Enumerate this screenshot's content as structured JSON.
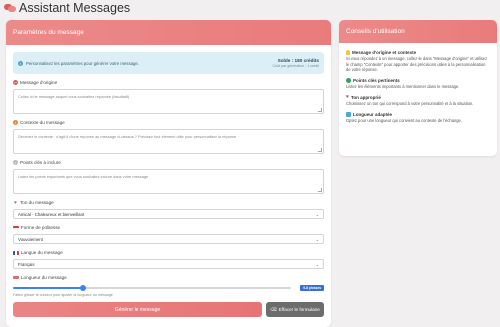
{
  "app": {
    "title": "Assistant Messages"
  },
  "main": {
    "header": "Paramètres du message",
    "info": {
      "text": "Personnalisez les paramètres pour générer votre message.",
      "balance": "Solde : 180 crédits",
      "cost": "Coût par génération : 1 crédit"
    },
    "fields": {
      "original": {
        "label": "Message d'origine",
        "placeholder": "Collez ici le message auquel vous souhaitez répondre (facultatif)"
      },
      "context": {
        "label": "Contexte du message",
        "placeholder": "Décrivez le contexte : s'agit-il d'une réponse au message ci-dessus ? Précisez tout élément utile pour personnaliser la réponse"
      },
      "keypoints": {
        "label": "Points clés à inclure",
        "placeholder": "Listez les points importants que vous souhaitez inclure dans votre message"
      },
      "tone": {
        "label": "Ton du message",
        "value": "Amical - Chaleureux et bienveillant"
      },
      "politeness": {
        "label": "Forme de politesse",
        "value": "Vouvoiement"
      },
      "language": {
        "label": "Langue du message",
        "value": "Français"
      },
      "length": {
        "label": "Longueur du message",
        "badge": "9-8 phrases",
        "value_fraction": 0.25,
        "hint": "Faites glisser le curseur pour ajuster la longueur du message"
      }
    },
    "buttons": {
      "generate": "Générer le message",
      "clear": "Effacer le formulaire"
    }
  },
  "tips": {
    "header": "Conseils d'utilisation",
    "items": [
      {
        "title": "Message d'origine et contexte",
        "text": "Si vous répondez à un message, collez-le dans \"Message d'origine\" et utilisez le champ \"Contexte\" pour apporter des précisions utiles à la personnalisation de votre réponse."
      },
      {
        "title": "Points clés pertinents",
        "text": "Listez les éléments importants à mentionner dans le message."
      },
      {
        "title": "Ton approprié",
        "text": "Choisissez un ton qui correspond à votre personnalité et à la situation."
      },
      {
        "title": "Longueur adaptée",
        "text": "Optez pour une longueur qui convient au contexte de l'échange."
      }
    ]
  },
  "colors": {
    "accent": "#e97b7b",
    "slider": "#3b82f6",
    "info_bg": "#dceff6"
  }
}
